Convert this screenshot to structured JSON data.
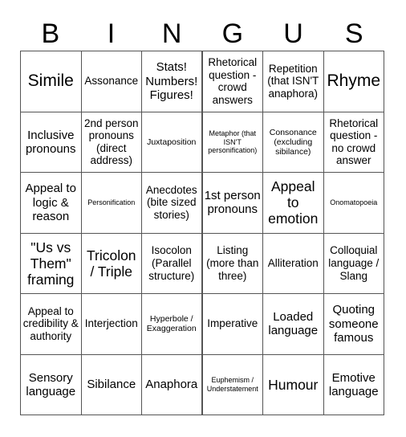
{
  "title_letters": [
    "B",
    "I",
    "N",
    "G",
    "U",
    "S"
  ],
  "board": {
    "rows": [
      [
        {
          "text": "Simile",
          "size": "xxl"
        },
        {
          "text": "Assonance",
          "size": "m"
        },
        {
          "text": "Stats! Numbers! Figures!",
          "size": "l"
        },
        {
          "text": "Rhetorical question - crowd answers",
          "size": "m"
        },
        {
          "text": "Repetition (that ISN'T anaphora)",
          "size": "m"
        },
        {
          "text": "Rhyme",
          "size": "xxl"
        }
      ],
      [
        {
          "text": "Inclusive pronouns",
          "size": "l"
        },
        {
          "text": "2nd person pronouns (direct address)",
          "size": "m"
        },
        {
          "text": "Juxtaposition",
          "size": "s"
        },
        {
          "text": "Metaphor (that ISN'T personification)",
          "size": "xs"
        },
        {
          "text": "Consonance (excluding sibilance)",
          "size": "s"
        },
        {
          "text": "Rhetorical question - no crowd answer",
          "size": "m"
        }
      ],
      [
        {
          "text": "Appeal to logic & reason",
          "size": "l"
        },
        {
          "text": "Personification",
          "size": "xs"
        },
        {
          "text": "Anecdotes (bite sized stories)",
          "size": "m"
        },
        {
          "text": "1st person pronouns",
          "size": "l"
        },
        {
          "text": "Appeal to emotion",
          "size": "xl"
        },
        {
          "text": "Onomatopoeia",
          "size": "xs"
        }
      ],
      [
        {
          "text": "\"Us vs Them\" framing",
          "size": "xl"
        },
        {
          "text": "Tricolon / Triple",
          "size": "xl"
        },
        {
          "text": "Isocolon (Parallel structure)",
          "size": "m"
        },
        {
          "text": "Listing (more than three)",
          "size": "m"
        },
        {
          "text": "Alliteration",
          "size": "m"
        },
        {
          "text": "Colloquial language / Slang",
          "size": "m"
        }
      ],
      [
        {
          "text": "Appeal to credibility & authority",
          "size": "m"
        },
        {
          "text": "Interjection",
          "size": "m"
        },
        {
          "text": "Hyperbole / Exaggeration",
          "size": "s"
        },
        {
          "text": "Imperative",
          "size": "m"
        },
        {
          "text": "Loaded language",
          "size": "l"
        },
        {
          "text": "Quoting someone famous",
          "size": "l"
        }
      ],
      [
        {
          "text": "Sensory language",
          "size": "l"
        },
        {
          "text": "Sibilance",
          "size": "l"
        },
        {
          "text": "Anaphora",
          "size": "l"
        },
        {
          "text": "Euphemism / Understatement",
          "size": "xs"
        },
        {
          "text": "Humour",
          "size": "xl"
        },
        {
          "text": "Emotive language",
          "size": "l"
        }
      ]
    ]
  }
}
